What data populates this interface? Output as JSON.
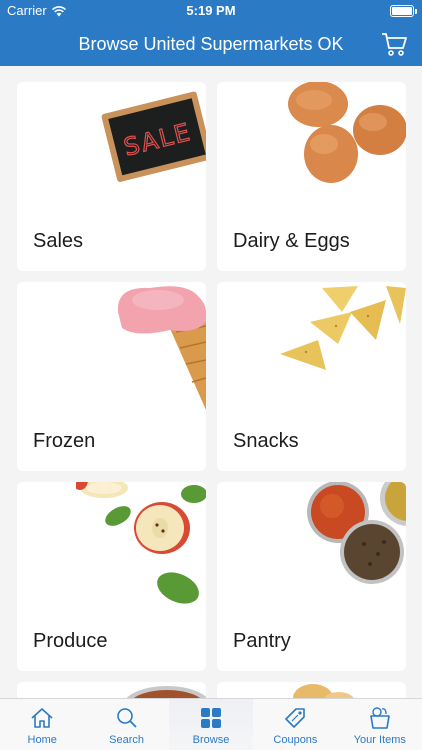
{
  "status_bar": {
    "carrier": "Carrier",
    "time": "5:19 PM",
    "battery_level": 1.0
  },
  "nav": {
    "title": "Browse United Supermarkets OK",
    "cart_icon": "cart-icon"
  },
  "categories": [
    {
      "label": "Sales",
      "icon": "sale-chalkboard"
    },
    {
      "label": "Dairy & Eggs",
      "icon": "eggs"
    },
    {
      "label": "Frozen",
      "icon": "ice-cream-cone"
    },
    {
      "label": "Snacks",
      "icon": "tortilla-chips"
    },
    {
      "label": "Produce",
      "icon": "apples"
    },
    {
      "label": "Pantry",
      "icon": "spice-bowls"
    }
  ],
  "sale_sign_text": "SALE",
  "tabs": [
    {
      "label": "Home",
      "icon": "home-icon",
      "active": false
    },
    {
      "label": "Search",
      "icon": "search-icon",
      "active": false
    },
    {
      "label": "Browse",
      "icon": "grid-icon",
      "active": true
    },
    {
      "label": "Coupons",
      "icon": "tag-icon",
      "active": false
    },
    {
      "label": "Your Items",
      "icon": "basket-icon",
      "active": false
    }
  ],
  "colors": {
    "brand": "#2b7ac6",
    "tile_bg": "#ffffff",
    "page_bg": "#f4f4f4"
  }
}
